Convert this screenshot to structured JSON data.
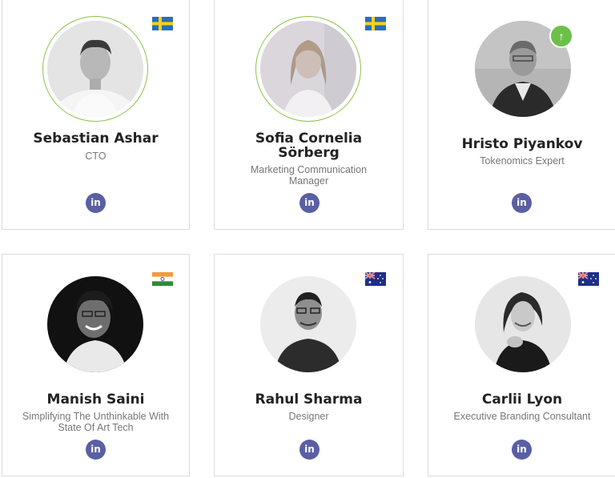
{
  "team": [
    {
      "name": "Sebastian Ashar",
      "role": "CTO",
      "flag": "sweden-flag-icon",
      "social": "in"
    },
    {
      "name": "Sofia Cornelia Sörberg",
      "role": "Marketing Communication Manager",
      "flag": "sweden-flag-icon",
      "social": "in"
    },
    {
      "name": "Hristo Piyankov",
      "role": "Tokenomics Expert",
      "badge": "up-arrow-icon",
      "social": "in"
    },
    {
      "name": "Manish Saini",
      "role": "Simplifying The Unthinkable With State Of Art Tech",
      "flag": "india-flag-icon",
      "social": "in"
    },
    {
      "name": "Rahul Sharma",
      "role": "Designer",
      "flag": "australia-flag-icon",
      "social": "in"
    },
    {
      "name": "Carlii Lyon",
      "role": "Executive Branding Consultant",
      "flag": "australia-flag-icon",
      "social": "in"
    }
  ],
  "colors": {
    "linkedin": "#5a5fa4",
    "ring": "#8bc34a",
    "badge": "#6cc04a",
    "name": "#222222",
    "role": "#777777",
    "border": "#dcdcdc"
  }
}
